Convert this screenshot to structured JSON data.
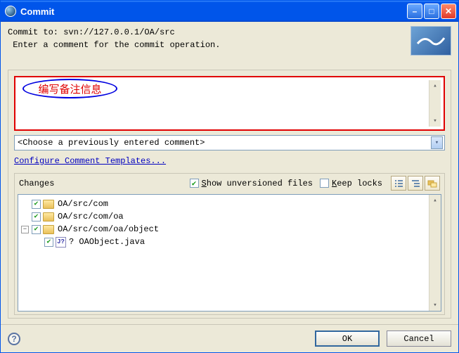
{
  "window": {
    "title": "Commit"
  },
  "header": {
    "line1": "Commit to: svn://127.0.0.1/OA/src",
    "line2": " Enter a comment for the commit operation."
  },
  "comment": {
    "annotation": "编写备注信息",
    "prev_placeholder": "<Choose a previously entered comment>",
    "configure_link": "Configure Comment Templates..."
  },
  "changes": {
    "label": "Changes",
    "show_unversioned": {
      "checked": true,
      "label_pre": "S",
      "label_rest": "how unversioned files"
    },
    "keep_locks": {
      "checked": false,
      "label_pre": "K",
      "label_rest": "eep locks"
    },
    "tree": [
      {
        "level": 0,
        "exp": "",
        "checked": true,
        "type": "folder",
        "label": "OA/src/com"
      },
      {
        "level": 0,
        "exp": "",
        "checked": true,
        "type": "folder",
        "label": "OA/src/com/oa"
      },
      {
        "level": 0,
        "exp": "minus",
        "checked": true,
        "type": "folder",
        "label": "OA/src/com/oa/object"
      },
      {
        "level": 1,
        "exp": "",
        "checked": true,
        "type": "file",
        "label": "? OAObject.java"
      }
    ]
  },
  "footer": {
    "ok": "OK",
    "cancel": "Cancel"
  }
}
